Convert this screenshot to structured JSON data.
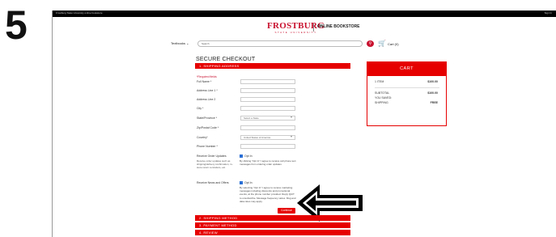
{
  "step_number": "5",
  "topbar": {
    "left_text": "Frostburg State University online bookstore",
    "right_text": "Sign In"
  },
  "header": {
    "brand": "FROSTBURG",
    "brand_sub": "STATE UNIVERSITY",
    "store_label": "ONLINE BOOKSTORE"
  },
  "nav": {
    "textbooks_label": "Textbooks ⌄",
    "search_placeholder": "Search",
    "cart_label": "Cart (0)"
  },
  "page_title": "SECURE CHECKOUT",
  "sections": {
    "shipping": "1. SHIPPING ADDRESS",
    "method": "2. SHIPPING METHOD",
    "payment": "3. PAYMENT METHOD",
    "review": "4. REVIEW"
  },
  "form": {
    "required_note": "*Required fields",
    "fields": [
      {
        "label": "Full Name *",
        "value": ""
      },
      {
        "label": "Address Line 1 *",
        "value": ""
      },
      {
        "label": "Address Line 2",
        "value": ""
      },
      {
        "label": "City *",
        "value": ""
      },
      {
        "label": "State/Province *",
        "value": "Select a State"
      },
      {
        "label": "Zip/Postal Code *",
        "value": ""
      },
      {
        "label": "Country*",
        "value": "United States of America"
      },
      {
        "label": "Phone Number *",
        "value": ""
      }
    ],
    "order_updates": {
      "label": "Receive Order Updates",
      "description": "Receive order updates such as shipping/delivery confirmation, in-store return reminders, etc.",
      "optin_label": "Opt In",
      "optin_text": "By clicking \"Opt In\" I agree to receive cell phone text messages from ordering order updates."
    },
    "news_offers": {
      "label": "Receive News and Offers",
      "optin_label": "Opt In",
      "optin_text": "By selecting \"Opt In\" I agree to receive marketing messages including discounts and promotional events, at the phone number provided. Reply QUIT to unsubscribe. Message frequency varies. Msg and data rates may apply."
    },
    "continue_label": "Continue"
  },
  "cart": {
    "title": "CART",
    "rows": [
      {
        "label": "1 ITEM",
        "value": "$100.00"
      },
      {
        "label": "SUBTOTAL",
        "value": "$100.00"
      },
      {
        "label": "YOU SAVED:",
        "value": ""
      },
      {
        "label": "SHIPPING",
        "value": "FREE"
      }
    ]
  },
  "colors": {
    "accent": "#e60000",
    "brand": "#c8102e"
  }
}
